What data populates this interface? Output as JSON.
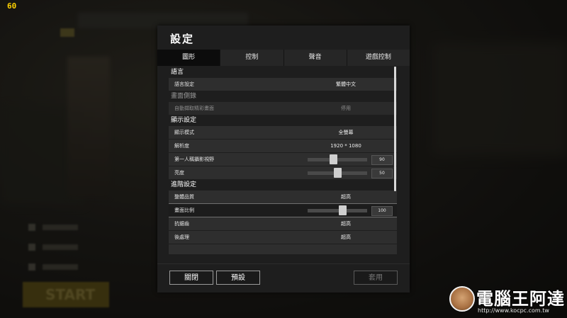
{
  "fps": "60",
  "background": {
    "start_label": "START"
  },
  "dialog": {
    "title": "設定",
    "tabs": [
      {
        "label": "圖形",
        "active": true
      },
      {
        "label": "控制",
        "active": false
      },
      {
        "label": "聲音",
        "active": false
      },
      {
        "label": "遊戲控制",
        "active": false
      }
    ],
    "sections": {
      "language": "語言",
      "replay": "畫面側錄",
      "display": "顯示設定",
      "advanced": "進階設定"
    },
    "rows": {
      "language_setting": {
        "label": "語言設定",
        "value": "繁體中文"
      },
      "auto_capture": {
        "label": "自動擷取精彩畫面",
        "value": "停用"
      },
      "display_mode": {
        "label": "顯示模式",
        "value": "全螢幕"
      },
      "resolution": {
        "label": "解析度",
        "value": "1920 * 1080"
      },
      "fov": {
        "label": "第一人稱攝影視野",
        "value": "90",
        "fraction": 0.43
      },
      "brightness": {
        "label": "亮度",
        "value": "50",
        "fraction": 0.5
      },
      "overall_quality": {
        "label": "整體品質",
        "value": "超高"
      },
      "screen_scale": {
        "label": "畫面比例",
        "value": "100",
        "fraction": 0.6
      },
      "anti_aliasing": {
        "label": "抗鋸齒",
        "value": "超高"
      },
      "post_processing": {
        "label": "後處理",
        "value": "超高"
      }
    },
    "buttons": {
      "close": "關閉",
      "default": "預設",
      "apply": "套用"
    }
  },
  "watermark": {
    "brand": "電腦王阿達",
    "url": "http://www.kocpc.com.tw"
  }
}
